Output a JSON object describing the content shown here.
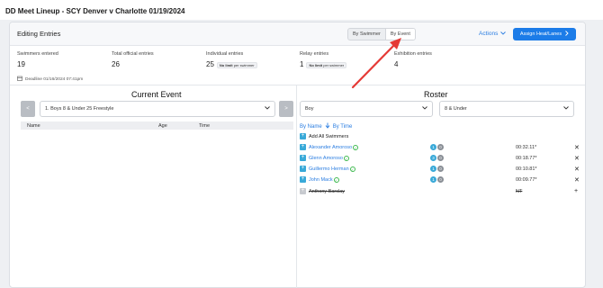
{
  "page": {
    "title": "DD Meet Lineup - SCY Denver v Charlotte 01/19/2024"
  },
  "header": {
    "editing_title": "Editing Entries",
    "view_toggle": [
      "By Swimmer",
      "By Event"
    ],
    "active_view": "By Event",
    "actions_label": "Actions",
    "assign_label": "Assign Heat/Lanes"
  },
  "stats": {
    "swimmers_entered": {
      "label": "Swimmers entered",
      "value": "19"
    },
    "total_official": {
      "label": "Total official entries",
      "value": "26"
    },
    "individual": {
      "label": "Individual entries",
      "value": "25",
      "note_bold": "No limit",
      "note_rest": "per swimmer"
    },
    "relay": {
      "label": "Relay entries",
      "value": "1",
      "note_bold": "No limit",
      "note_rest": "per swimmer"
    },
    "exhibition": {
      "label": "Exhibition entries",
      "value": "4"
    }
  },
  "deadline": "Deadline 01/16/2024 07:41pm",
  "current_event": {
    "title": "Current Event",
    "prev": "<",
    "next": ">",
    "selected": "1. Boys 8 & Under 25 Freestyle",
    "columns": [
      "Name",
      "Age",
      "Time"
    ]
  },
  "roster": {
    "title": "Roster",
    "gender": "Boy",
    "age_group": "8 & Under",
    "sort_by_name": "By Name",
    "sort_by_time": "By Time",
    "add_all": "Add All Swimmers",
    "swimmers": [
      {
        "name": "Alexander Amoroso",
        "badge1": "1",
        "badge2": "0",
        "time": "00:32.11*",
        "action": "✕"
      },
      {
        "name": "Glenn Amoroso",
        "badge1": "3",
        "badge2": "0",
        "time": "00:18.77*",
        "action": "✕"
      },
      {
        "name": "Guillermo Herman",
        "badge1": "1",
        "badge2": "0",
        "time": "00:10.81*",
        "action": "✕"
      },
      {
        "name": "John Mack",
        "badge1": "1",
        "badge2": "0",
        "time": "00:09.77*",
        "action": "✕"
      },
      {
        "name": "Anthony Barclay",
        "time": "NT",
        "action": "+"
      }
    ]
  },
  "colors": {
    "accent": "#1c7ce8",
    "link": "#2a7de1",
    "badge": "#39a9d8",
    "check": "#3fb950",
    "annotation_arrow": "#e53935"
  }
}
